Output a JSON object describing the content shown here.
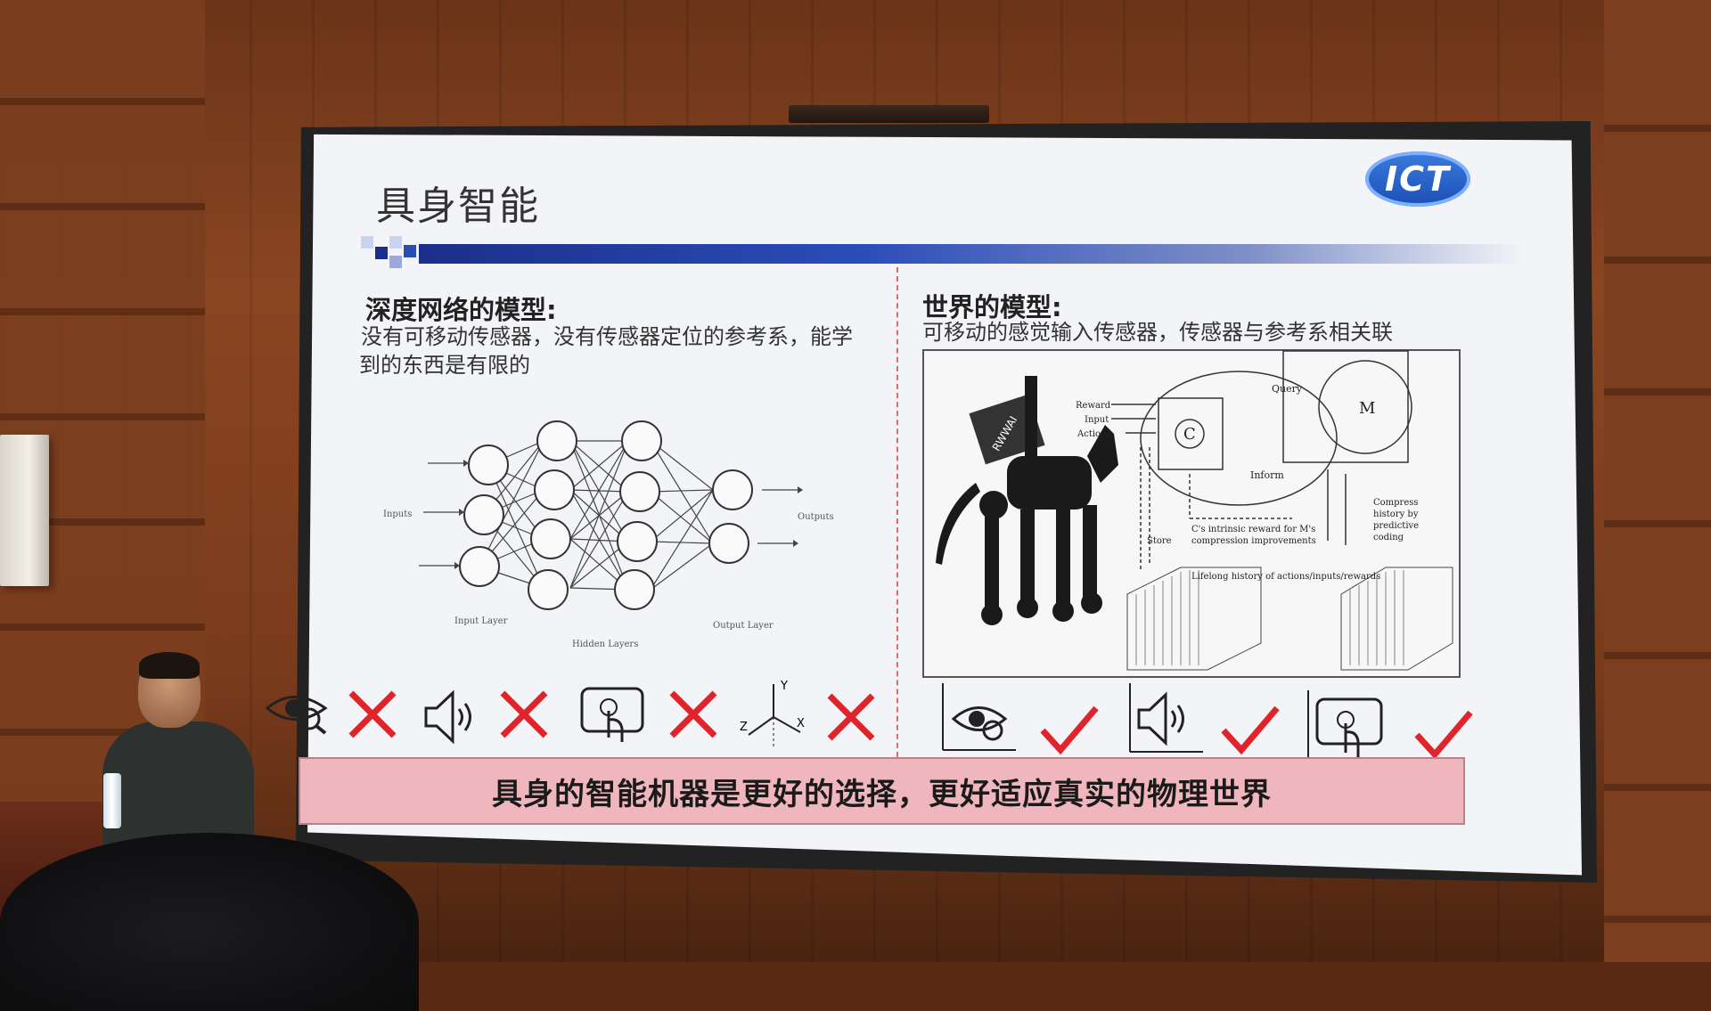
{
  "slide": {
    "title": "具身智能",
    "logo_text": "ICT",
    "left": {
      "heading": "深度网络的模型:",
      "desc_line1": "没有可移动传感器，没有传感器定位的参考系，能学",
      "desc_line2": "到的东西是有限的",
      "nn_labels": {
        "inputs": "Inputs",
        "outputs": "Outputs",
        "input_layer": "Input Layer",
        "hidden_layers": "Hidden Layers",
        "output_layer": "Output Layer"
      },
      "axis_labels": {
        "y": "Y",
        "z": "Z",
        "x": "X"
      }
    },
    "right": {
      "heading": "世界的模型:",
      "desc": "可移动的感觉输入传感器，传感器与参考系相关联",
      "diagram": {
        "reward": "Reward",
        "input": "Input",
        "actions": "Actions",
        "query": "Query",
        "inform": "Inform",
        "c": "C",
        "m": "M",
        "store": "Store",
        "intrinsic_line1": "C's intrinsic reward for M's",
        "intrinsic_line2": "compression improvements",
        "compress_line1": "Compress",
        "compress_line2": "history by",
        "compress_line3": "predictive",
        "compress_line4": "coding",
        "lifelong": "Lifelong history of actions/inputs/rewards",
        "robot_label": "RWWAI"
      }
    },
    "banner": "具身的智能机器是更好的选择，更好适应真实的物理世界"
  },
  "colors": {
    "cross": "#e0242b",
    "check": "#e0242b",
    "banner_bg": "#f0b6bd",
    "title_bar": "#1b2f8a",
    "logo": "#2a63cc"
  }
}
